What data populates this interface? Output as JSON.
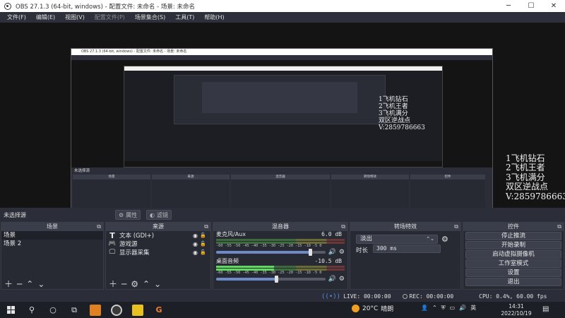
{
  "window": {
    "title": "OBS 27.1.3 (64-bit, windows) - 配置文件: 未命名 - 场景: 未命名"
  },
  "menu": [
    "文件(F)",
    "编辑(E)",
    "视图(V)",
    "配置文件(P)",
    "场景集合(S)",
    "工具(T)",
    "帮助(H)"
  ],
  "overlay_text": "1飞机钻石\n2飞机王者\n3飞机满分\n双区逆战点\nV:2859786663",
  "dock_bar": {
    "no_source": "未选择源",
    "properties": "属性",
    "filters": "滤镜"
  },
  "scenes": {
    "title": "场景",
    "items": [
      "场景",
      "场景 2"
    ]
  },
  "sources": {
    "title": "来源",
    "items": [
      {
        "name": "文本 (GDI+)",
        "icon": "text-icon"
      },
      {
        "name": "游戏源",
        "icon": "gamepad-icon"
      },
      {
        "name": "显示器采集",
        "icon": "monitor-icon"
      }
    ]
  },
  "mixer": {
    "title": "混音器",
    "ticks": "-60 -55 -50 -45 -40 -35 -30 -25 -20 -15 -10 -5 0",
    "channels": [
      {
        "name": "麦克风/Aux",
        "db": "6.0 dB",
        "level": 0.86
      },
      {
        "name": "桌面音频",
        "db": "-10.5 dB",
        "level": 0.55
      }
    ]
  },
  "transitions": {
    "title": "转场特效",
    "selected": "淡出",
    "duration_label": "时长",
    "duration": "300 ms"
  },
  "controls": {
    "title": "控件",
    "buttons": [
      "停止推流",
      "开始录制",
      "启动虚拟摄像机",
      "工作室模式",
      "设置",
      "退出"
    ]
  },
  "status": {
    "live": "LIVE: 00:00:00",
    "rec": "REC: 00:00:00",
    "cpu": "CPU: 0.4%, 60.00 fps"
  },
  "taskbar": {
    "weather_temp": "20°C",
    "weather_text": "晴朗",
    "ime": "英",
    "time": "14:31",
    "date": "2022/10/19"
  },
  "colors": {
    "accent": "#4a8fe0",
    "meter_green": "#5edb5e",
    "bg": "#2b2e38"
  }
}
